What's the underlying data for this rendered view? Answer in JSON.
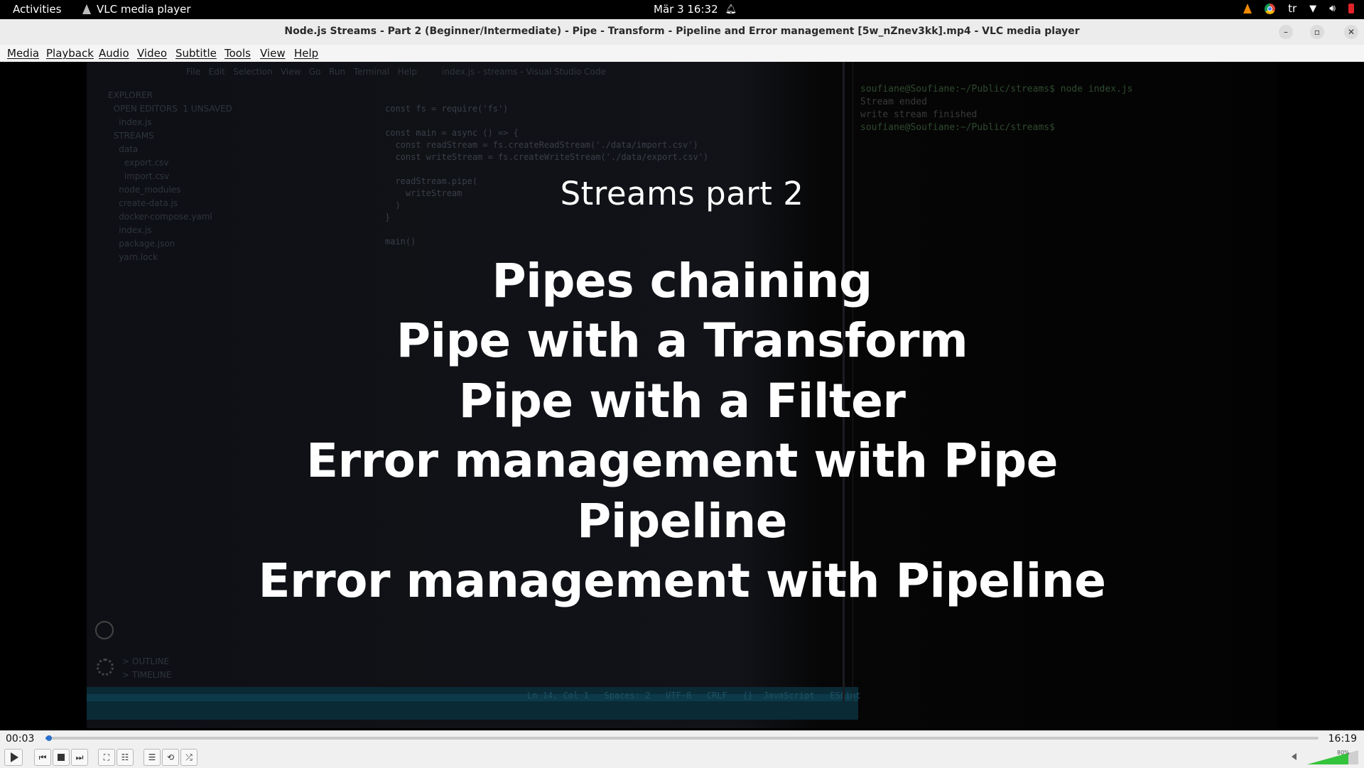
{
  "topbar": {
    "activities": "Activities",
    "app_name": "VLC media player",
    "clock": "Mär 3  16:32",
    "keyboard_layout": "tr",
    "icons": [
      "vlc-icon",
      "bell-icon",
      "chrome-icon",
      "wifi-icon",
      "volume-icon",
      "power-icon"
    ]
  },
  "window": {
    "title": "Node.js Streams - Part 2 (Beginner/Intermediate) - Pipe - Transform - Pipeline and Error management [5w_nZnev3kk].mp4 - VLC media player",
    "minimize": "–",
    "maximize": "▫",
    "close": "✕"
  },
  "menu": [
    "Media",
    "Playback",
    "Audio",
    "Video",
    "Subtitle",
    "Tools",
    "View",
    "Help"
  ],
  "video_overlay": {
    "title": "Streams part 2",
    "lines": [
      "Pipes chaining",
      "Pipe with a Transform",
      "Pipe with a Filter",
      "Error management with Pipe",
      "Pipeline",
      "Error management with Pipeline"
    ]
  },
  "background_editor": {
    "window_title": "index.js - streams - Visual Studio Code",
    "menus": "File   Edit   Selection   View   Go   Run   Terminal   Help",
    "sidebar": "EXPLORER\n  OPEN EDITORS  1 UNSAVED\n    index.js\n  STREAMS\n    data\n      export.csv\n      import.csv\n    node_modules\n    create-data.js\n    docker-compose.yaml\n    index.js\n    package.json\n    yarn.lock",
    "code": "const fs = require('fs')\n\nconst main = async () => {\n  const readStream = fs.createReadStream('./data/import.csv')\n  const writeStream = fs.createWriteStream('./data/export.csv')\n\n  readStream.pipe(\n    writeStream\n  )\n}\n\nmain()",
    "outline": "> OUTLINE\n> TIMELINE",
    "status": "Ln 14, Col 1   Spaces: 2   UTF-8   CRLF   {}  JavaScript   ESLint",
    "terminal_prompt": "soufiane@Soufiane:~/Public/streams$ node index.js",
    "terminal_out1": "Stream ended",
    "terminal_out2": "write stream finished",
    "terminal_prompt2": "soufiane@Soufiane:~/Public/streams$"
  },
  "player": {
    "time_current": "00:03",
    "time_total": "16:19",
    "progress_fraction": 0.003,
    "volume_percent": 80,
    "volume_label": "80%",
    "buttons": [
      "play-button",
      "previous-button",
      "stop-button",
      "next-button",
      "fullscreen-button",
      "extended-settings-button",
      "playlist-button",
      "loop-button",
      "shuffle-button"
    ]
  }
}
